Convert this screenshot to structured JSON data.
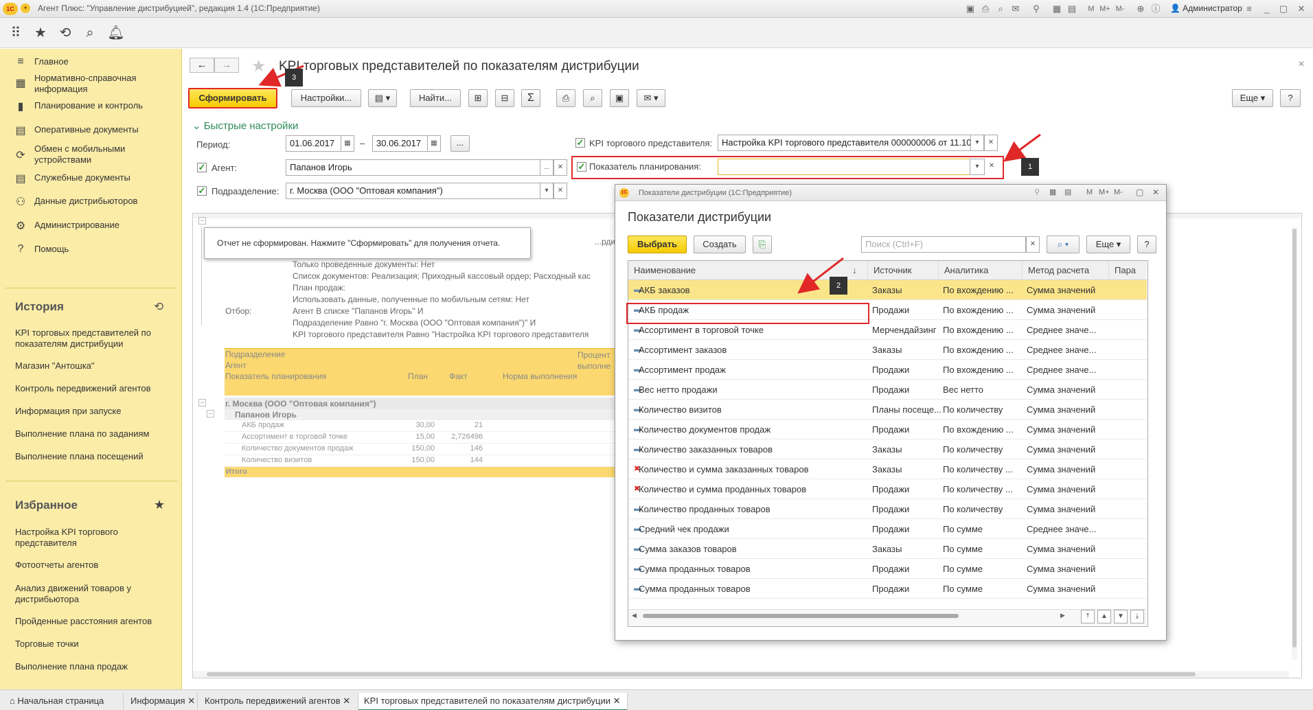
{
  "app": {
    "title": "Агент Плюс: \"Управление дистрибуцией\", редакция 1.4  (1С:Предприятие)",
    "user": "Администратор"
  },
  "sidebar": {
    "nav": [
      {
        "label": "Главное",
        "icon": "home-icon"
      },
      {
        "label": "Нормативно-справочная информация",
        "icon": "reference-icon"
      },
      {
        "label": "Планирование и контроль",
        "icon": "chart-icon"
      },
      {
        "label": "Оперативные документы",
        "icon": "document-icon"
      },
      {
        "label": "Обмен с мобильными устройствами",
        "icon": "sync-icon"
      },
      {
        "label": "Служебные документы",
        "icon": "document-icon"
      },
      {
        "label": "Данные дистрибьюторов",
        "icon": "people-icon"
      },
      {
        "label": "Администрирование",
        "icon": "gear-icon"
      },
      {
        "label": "Помощь",
        "icon": "help-icon"
      }
    ],
    "history_title": "История",
    "history": [
      "KPI торговых представителей по показателям дистрибуции",
      "Магазин \"Антошка\"",
      "Контроль передвижений агентов",
      "Информация при запуске",
      "Выполнение плана по заданиям",
      "Выполнение плана посещений"
    ],
    "favorites_title": "Избранное",
    "favorites": [
      "Настройка KPI торгового представителя",
      "Фотоотчеты агентов",
      "Анализ движений товаров у дистрибьютора",
      "Пройденные расстояния агентов",
      "Торговые точки",
      "Выполнение плана продаж"
    ]
  },
  "main": {
    "title": "KPI торговых представителей по показателям дистрибуции",
    "buttons": {
      "generate": "Сформировать",
      "settings": "Настройки...",
      "find": "Найти...",
      "more": "Еще",
      "help": "?"
    },
    "quick_settings": "Быстрые настройки",
    "period_label": "Период:",
    "period_from": "01.06.2017",
    "period_dash": "–",
    "period_to": "30.06.2017",
    "period_ellipsis": "...",
    "agent_label": "Агент:",
    "agent_value": "Папанов Игорь",
    "dept_label": "Подразделение:",
    "dept_value": "г. Москва  (ООО \"Оптовая компания\")",
    "kpi_label": "KPI торгового представителя:",
    "kpi_value": "Настройка KPI торгового представителя 000000006 от 11.10.",
    "indicator_label": "Показатель планирования:",
    "indicator_value": ""
  },
  "report": {
    "message": "Отчет не сформирован. Нажмите \"Сформировать\" для получения отчета.",
    "params": [
      "...рдинатам документ",
      "Только проведенные документы: Нет",
      "Список документов: Реализация; Приходный кассовый ордер; Расходный кас",
      "План продаж:",
      "Использовать данные, полученные по мобильным сетям: Нет"
    ],
    "filter_label": "Отбор:",
    "filters": [
      "Агент В списке \"Папанов Игорь\" И",
      "Подразделение Равно \"г. Москва  (ООО \"Оптовая компания\")\" И",
      " KPI торгового представителя Равно \"Настройка KPI торгового представителя"
    ],
    "header": {
      "col1": [
        "Подразделение",
        "Агент",
        "Показатель планирования"
      ],
      "plan": "План",
      "fact": "Факт",
      "norm": "Норма выполнения",
      "pct": "Процент выполне"
    },
    "group": "г. Москва  (ООО \"Оптовая компания\")",
    "agent": "Папанов Игорь",
    "rows": [
      {
        "name": "АКБ продаж",
        "plan": "30,00",
        "fact": "21"
      },
      {
        "name": "Ассортимент в торговой точке",
        "plan": "15,00",
        "fact": "2,726496"
      },
      {
        "name": "Количество документов продаж",
        "plan": "150,00",
        "fact": "146"
      },
      {
        "name": "Количество визитов",
        "plan": "150,00",
        "fact": "144"
      }
    ],
    "total": "Итого"
  },
  "popup": {
    "window_title": "Показатели дистрибуции  (1С:Предприятие)",
    "title": "Показатели дистрибуции",
    "select": "Выбрать",
    "create": "Создать",
    "search_placeholder": "Поиск (Ctrl+F)",
    "more": "Еще",
    "help": "?",
    "columns": [
      "Наименование",
      "Источник",
      "Аналитика",
      "Метод расчета",
      "Пара"
    ],
    "rows": [
      {
        "name": "АКБ заказов",
        "source": "Заказы",
        "analytics": "По вхождению ...",
        "method": "Сумма значений",
        "icon": "normal"
      },
      {
        "name": "АКБ продаж",
        "source": "Продажи",
        "analytics": "По вхождению ...",
        "method": "Сумма значений",
        "icon": "normal"
      },
      {
        "name": "Ассортимент в торговой точке",
        "source": "Мерчендайзинг",
        "analytics": "По вхождению ...",
        "method": "Среднее значе...",
        "icon": "normal"
      },
      {
        "name": "Ассортимент заказов",
        "source": "Заказы",
        "analytics": "По вхождению ...",
        "method": "Среднее значе...",
        "icon": "normal"
      },
      {
        "name": "Ассортимент продаж",
        "source": "Продажи",
        "analytics": "По вхождению ...",
        "method": "Среднее значе...",
        "icon": "normal"
      },
      {
        "name": "Вес нетто продажи",
        "source": "Продажи",
        "analytics": "Вес нетто",
        "method": "Сумма значений",
        "icon": "normal"
      },
      {
        "name": "Количество визитов",
        "source": "Планы посеще...",
        "analytics": "По количеству",
        "method": "Сумма значений",
        "icon": "normal"
      },
      {
        "name": "Количество документов продаж",
        "source": "Продажи",
        "analytics": "По вхождению ...",
        "method": "Сумма значений",
        "icon": "normal"
      },
      {
        "name": "Количество заказанных товаров",
        "source": "Заказы",
        "analytics": "По количеству",
        "method": "Сумма значений",
        "icon": "normal"
      },
      {
        "name": "Количество и сумма заказанных товаров",
        "source": "Заказы",
        "analytics": "По количеству ...",
        "method": "Сумма значений",
        "icon": "deleted"
      },
      {
        "name": "Количество и сумма проданных товаров",
        "source": "Продажи",
        "analytics": "По количеству ...",
        "method": "Сумма значений",
        "icon": "deleted"
      },
      {
        "name": "Количество проданных товаров",
        "source": "Продажи",
        "analytics": "По количеству",
        "method": "Сумма значений",
        "icon": "normal"
      },
      {
        "name": "Средний чек продажи",
        "source": "Продажи",
        "analytics": "По сумме",
        "method": "Среднее значе...",
        "icon": "normal"
      },
      {
        "name": "Сумма заказов товаров",
        "source": "Заказы",
        "analytics": "По сумме",
        "method": "Сумма значений",
        "icon": "normal"
      },
      {
        "name": "Сумма проданных товаров",
        "source": "Продажи",
        "analytics": "По сумме",
        "method": "Сумма значений",
        "icon": "normal"
      },
      {
        "name": "Сумма проданных товаров",
        "source": "Продажи",
        "analytics": "По сумме",
        "method": "Сумма значений",
        "icon": "normal"
      }
    ]
  },
  "callouts": [
    "1",
    "2",
    "3"
  ],
  "tabs": [
    "Начальная страница",
    "Информация",
    "Контроль передвижений агентов",
    "KPI торговых представителей по показателям дистрибуции"
  ],
  "colors": {
    "accent_yellow": "#f5cb00",
    "sidebar_bg": "#fbeca8",
    "highlight_red": "#e02828",
    "green_link": "#2e8b57"
  }
}
